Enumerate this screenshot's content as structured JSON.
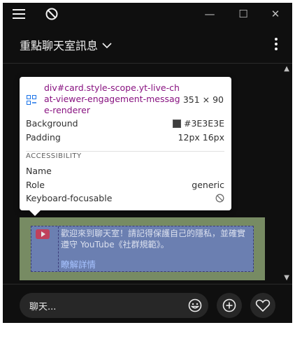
{
  "titlebar": {
    "menu_icon": "hamburger-icon",
    "no_anim_icon": "circle-slash-icon",
    "minimize_glyph": "—",
    "maximize_glyph": "☐",
    "close_glyph": "✕"
  },
  "header": {
    "title": "重點聊天室訊息",
    "dropdown_glyph": "⌵"
  },
  "tooltip": {
    "selector": "div#card.style-scope.yt-live-chat-viewer-engagement-message-renderer",
    "size": "351 × 90",
    "background_label": "Background",
    "background_value": "#3E3E3E",
    "padding_label": "Padding",
    "padding_value": "12px 16px",
    "section_title": "ACCESSIBILITY",
    "name_label": "Name",
    "name_value": "",
    "role_label": "Role",
    "role_value": "generic",
    "focusable_label": "Keyboard-focusable",
    "colors": {
      "selector": "#881280",
      "swatch": "#3e3e3e"
    }
  },
  "card": {
    "message": "歡迎來到聊天室！請記得保護自己的隱私，並確實遵守 YouTube《社群規範》。",
    "link": "瞭解詳情"
  },
  "input": {
    "placeholder": "聊天..."
  },
  "colors": {
    "background": "#0f0f0f",
    "card_highlight_padding": "#778b63",
    "card_highlight_content": "#6b7fb1"
  }
}
